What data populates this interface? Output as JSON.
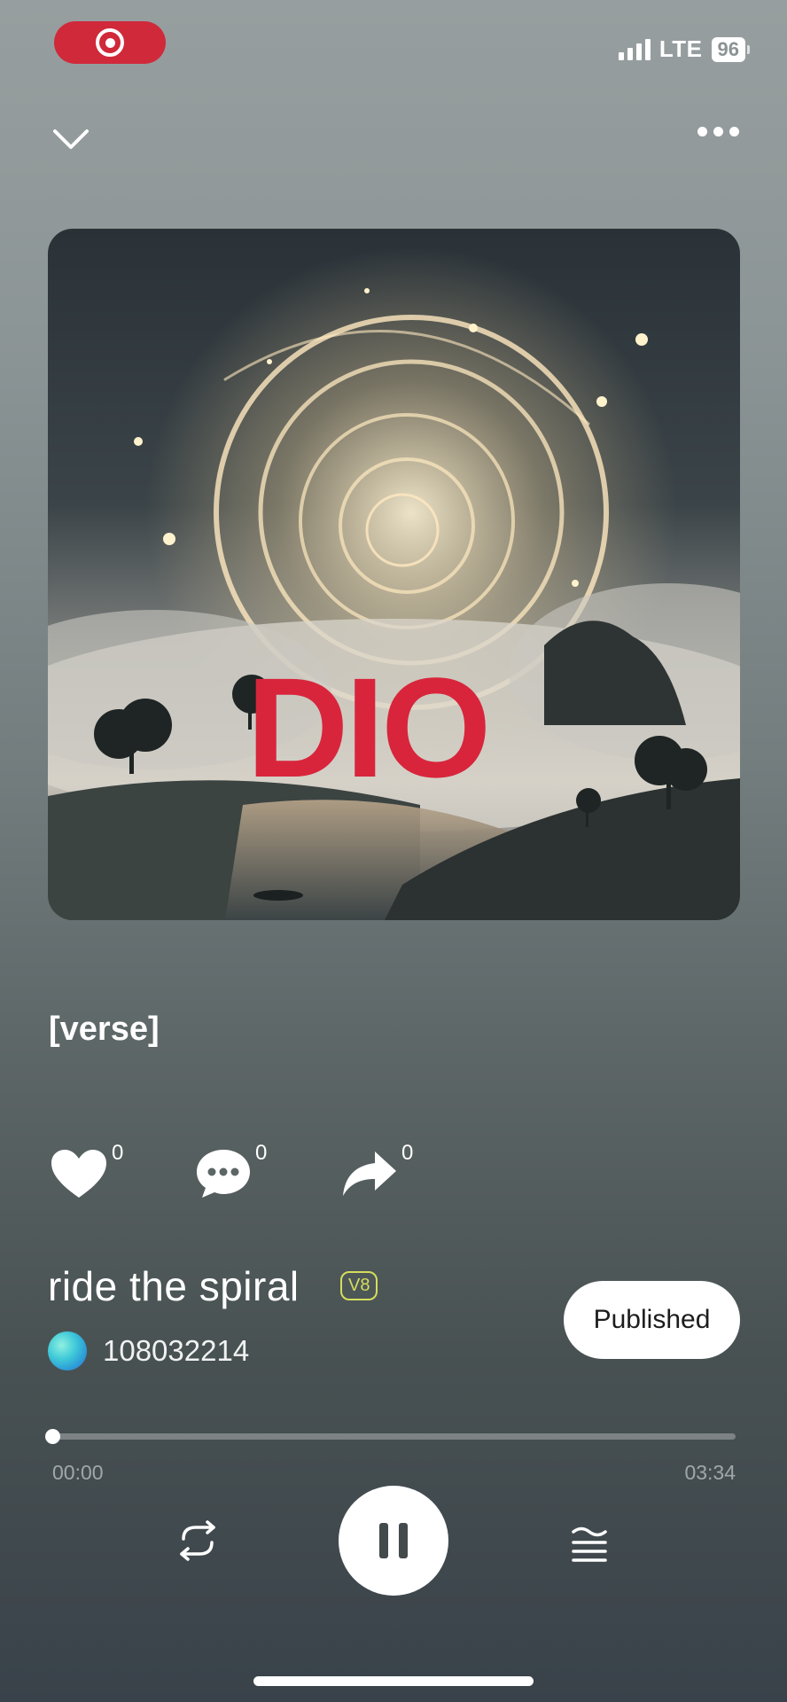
{
  "status_bar": {
    "network": "LTE",
    "battery": "96"
  },
  "artwork": {
    "title_text": "DIO"
  },
  "lyrics": {
    "section": "[verse]"
  },
  "actions": {
    "likes": "0",
    "comments": "0",
    "shares": "0"
  },
  "song": {
    "title": "ride the spiral",
    "version": "V8",
    "artist": "108032214",
    "publish_label": "Published"
  },
  "player": {
    "current_time": "00:00",
    "total_time": "03:34",
    "progress": 0.0
  },
  "icons": {
    "recording": "record-icon",
    "collapse": "chevron-down-icon",
    "more": "more-dots-icon",
    "like": "heart-icon",
    "comment": "comment-icon",
    "share": "share-icon",
    "repeat": "repeat-icon",
    "pause": "pause-icon",
    "queue": "queue-icon"
  },
  "colors": {
    "recording_pill": "#d0293a",
    "artwork_title": "#d8253c",
    "version_badge": "#d4dd5c"
  }
}
